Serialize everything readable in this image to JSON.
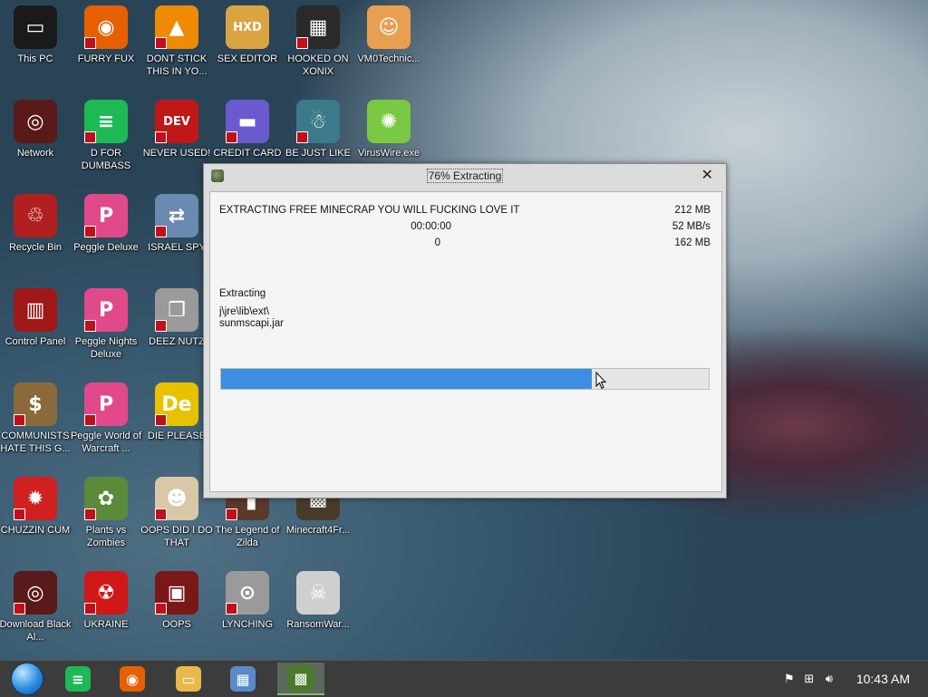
{
  "desktop_icons": [
    {
      "id": "this-pc",
      "label": "This PC",
      "icon": "monitor-icon",
      "color": "#1a1a1a",
      "glyph": "▭",
      "badge": false,
      "col": 0,
      "row": 0
    },
    {
      "id": "furry-fux",
      "label": "FURRY FUX",
      "icon": "firefox-icon",
      "color": "#e66000",
      "glyph": "◉",
      "badge": true,
      "col": 1,
      "row": 0
    },
    {
      "id": "dont-stick",
      "label": "DONT STICK THIS IN YO...",
      "icon": "vlc-cone-icon",
      "color": "#f08a00",
      "glyph": "▲",
      "badge": true,
      "col": 2,
      "row": 0
    },
    {
      "id": "sex-editor",
      "label": "SEX EDITOR",
      "icon": "hxd-icon",
      "color": "#d9a441",
      "glyph": "HXD",
      "badge": false,
      "col": 3,
      "row": 0
    },
    {
      "id": "hooked-on-xonix",
      "label": "HOOKED ON XONIX",
      "icon": "xonix-icon",
      "color": "#2a2a2a",
      "glyph": "▦",
      "badge": true,
      "col": 4,
      "row": 0
    },
    {
      "id": "vm0technic",
      "label": "VM0Technic...",
      "icon": "doctor-icon",
      "color": "#e8a050",
      "glyph": "☺",
      "badge": false,
      "col": 5,
      "row": 0
    },
    {
      "id": "network",
      "label": "Network",
      "icon": "network-orb-icon",
      "color": "#5a1a1a",
      "glyph": "◎",
      "badge": false,
      "col": 0,
      "row": 1
    },
    {
      "id": "d-for-dumbass",
      "label": "D FOR DUMBASS",
      "icon": "spotify-icon",
      "color": "#1db954",
      "glyph": "≡",
      "badge": true,
      "col": 1,
      "row": 1
    },
    {
      "id": "never-used",
      "label": "NEVER USED!",
      "icon": "dev-cpp-icon",
      "color": "#c01818",
      "glyph": "DEV",
      "badge": true,
      "col": 2,
      "row": 1
    },
    {
      "id": "credit-card",
      "label": "CREDIT CARD",
      "icon": "credit-card-icon",
      "color": "#6a5acd",
      "glyph": "▬",
      "badge": true,
      "col": 3,
      "row": 1
    },
    {
      "id": "be-just-like",
      "label": "BE JUST LIKE",
      "icon": "santa-icon",
      "color": "#3a7a8a",
      "glyph": "☃",
      "badge": true,
      "col": 4,
      "row": 1
    },
    {
      "id": "viruswire",
      "label": "VirusWire.exe",
      "icon": "lime-icon",
      "color": "#7ac943",
      "glyph": "✺",
      "badge": false,
      "col": 5,
      "row": 1
    },
    {
      "id": "recycle-bin",
      "label": "Recycle Bin",
      "icon": "recycle-bin-icon",
      "color": "#b02020",
      "glyph": "♲",
      "badge": false,
      "col": 0,
      "row": 2
    },
    {
      "id": "peggle-deluxe",
      "label": "Peggle Deluxe",
      "icon": "peggle-icon",
      "color": "#e04a8a",
      "glyph": "P",
      "badge": true,
      "col": 1,
      "row": 2
    },
    {
      "id": "israel-spy",
      "label": "ISRAEL SPY",
      "icon": "network-cable-icon",
      "color": "#6a8ab0",
      "glyph": "⇄",
      "badge": true,
      "col": 2,
      "row": 2
    },
    {
      "id": "control-panel",
      "label": "Control Panel",
      "icon": "control-panel-icon",
      "color": "#a01818",
      "glyph": "▥",
      "badge": false,
      "col": 0,
      "row": 3
    },
    {
      "id": "peggle-nights",
      "label": "Peggle Nights Deluxe",
      "icon": "peggle-nights-icon",
      "color": "#e04a8a",
      "glyph": "P",
      "badge": true,
      "col": 1,
      "row": 3
    },
    {
      "id": "deez-nutz",
      "label": "DEEZ NUTZ",
      "icon": "windows-stack-icon",
      "color": "#9a9a9a",
      "glyph": "❐",
      "badge": true,
      "col": 2,
      "row": 3
    },
    {
      "id": "communists",
      "label": "COMMUNISTS HATE THIS G...",
      "icon": "money-bag-icon",
      "color": "#8a6a3a",
      "glyph": "$",
      "badge": true,
      "col": 0,
      "row": 4
    },
    {
      "id": "peggle-world",
      "label": "Peggle World of Warcraft ...",
      "icon": "peggle-wow-icon",
      "color": "#e04a8a",
      "glyph": "P",
      "badge": true,
      "col": 1,
      "row": 4
    },
    {
      "id": "die-please",
      "label": "DIE PLEASE",
      "icon": "de-letters-icon",
      "color": "#e8c200",
      "glyph": "De",
      "badge": true,
      "col": 2,
      "row": 4
    },
    {
      "id": "chuzzin-cum",
      "label": "CHUZZIN CUM",
      "icon": "chuzzle-icon",
      "color": "#d02020",
      "glyph": "✹",
      "badge": true,
      "col": 0,
      "row": 5
    },
    {
      "id": "plants-vs-zombies",
      "label": "Plants vs Zombies",
      "icon": "pvz-flower-icon",
      "color": "#5a8a3a",
      "glyph": "✿",
      "badge": true,
      "col": 1,
      "row": 5
    },
    {
      "id": "oops-did-i",
      "label": "OOPS DID I DO THAT",
      "icon": "portrait-icon",
      "color": "#d8c8a8",
      "glyph": "☻",
      "badge": true,
      "col": 2,
      "row": 5
    },
    {
      "id": "legend-of-zilda",
      "label": "The Legend of Zilda",
      "icon": "pixel-hero-icon",
      "color": "#5a3a2a",
      "glyph": "▚",
      "badge": true,
      "col": 3,
      "row": 5
    },
    {
      "id": "minecraft4fr",
      "label": "Minecraft4Fr...",
      "icon": "grass-block-icon",
      "color": "#4a3a2a",
      "glyph": "▩",
      "badge": false,
      "col": 4,
      "row": 5
    },
    {
      "id": "download-black",
      "label": "Download Black Al...",
      "icon": "black-orb-icon",
      "color": "#5a1a1a",
      "glyph": "◎",
      "badge": true,
      "col": 0,
      "row": 6
    },
    {
      "id": "ukraine",
      "label": "UKRAINE",
      "icon": "radiation-icon",
      "color": "#d01818",
      "glyph": "☢",
      "badge": true,
      "col": 1,
      "row": 6
    },
    {
      "id": "oops",
      "label": "OOPS",
      "icon": "red-device-icon",
      "color": "#7a1818",
      "glyph": "▣",
      "badge": true,
      "col": 2,
      "row": 6
    },
    {
      "id": "lynching",
      "label": "LYNCHING",
      "icon": "noose-icon",
      "color": "#9a9a9a",
      "glyph": "⊙",
      "badge": true,
      "col": 3,
      "row": 6
    },
    {
      "id": "ransomware",
      "label": "RansomWar...",
      "icon": "skull-icon",
      "color": "#cfcfcf",
      "glyph": "☠",
      "badge": false,
      "col": 4,
      "row": 6
    }
  ],
  "dialog": {
    "title": "76% Extracting",
    "close_glyph": "✕",
    "header_label": "EXTRACTING FREE MINECRAP YOU WILL FUCKING LOVE IT",
    "total_size": "212 MB",
    "elapsed_time": "00:00:00",
    "speed": "52 MB/s",
    "processed_count": "0",
    "processed_size": "162 MB",
    "status_label": "Extracting",
    "current_path": "j\\jre\\lib\\ext\\",
    "current_file": "sunmscapi.jar",
    "progress": 0.76,
    "progress_color": "#3d8ee0"
  },
  "taskbar": {
    "start_icon": "start-orb-icon",
    "pinned": [
      {
        "id": "spotify",
        "icon": "spotify-icon",
        "color": "#1db954",
        "glyph": "≡",
        "active": false
      },
      {
        "id": "firefox",
        "icon": "firefox-icon",
        "color": "#e66000",
        "glyph": "◉",
        "active": false
      },
      {
        "id": "explorer",
        "icon": "folder-icon",
        "color": "#e8b84a",
        "glyph": "▭",
        "active": false
      },
      {
        "id": "remote-desktop",
        "icon": "computer-icon",
        "color": "#5a8ac8",
        "glyph": "▦",
        "active": false
      },
      {
        "id": "minecraft",
        "icon": "grass-block-icon",
        "color": "#4a7a2a",
        "glyph": "▩",
        "active": true
      }
    ],
    "tray_icons": [
      "flag-icon",
      "network-tray-icon",
      "volume-icon"
    ],
    "clock": "10:43 AM"
  }
}
